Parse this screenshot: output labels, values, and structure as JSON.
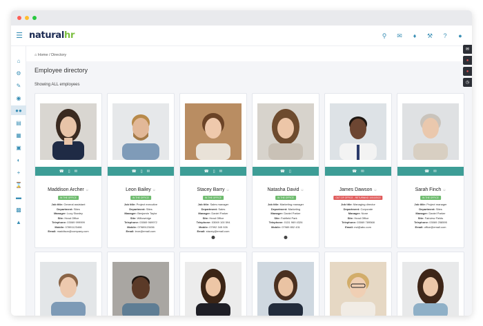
{
  "app": {
    "logo_main": "natural",
    "logo_accent": "hr"
  },
  "breadcrumb": {
    "home": "Home",
    "separator": "/",
    "current": "Directory"
  },
  "page": {
    "title": "Employee directory",
    "subtitle": "Showing ALL employees"
  },
  "colors": {
    "accent": "#3a8fb5",
    "teal": "#3d9d96",
    "in_office": "#6dbb6d",
    "out_office": "#e05a5a"
  },
  "employees": [
    {
      "name": "Maddison Archer",
      "status": "IN THE OFFICE",
      "status_type": "in",
      "job_title": "General assistant",
      "department": "Sites",
      "manager": "Lucy Stanley",
      "site": "Head Office",
      "telephone": "03069 999999",
      "mobile": "07891123466",
      "email": "maddison@company.com",
      "actions": [
        "phone",
        "mobile",
        "mail"
      ]
    },
    {
      "name": "Leon Bailey",
      "status": "IN THE OFFICE",
      "status_type": "in",
      "job_title": "Project executive",
      "department": "Sites",
      "manager": "Benjamin Taylor",
      "site": "Willowridge",
      "telephone": "03069 969972",
      "mobile": "07989123456",
      "email": "leon@email.com",
      "actions": [
        "phone",
        "mobile",
        "mail"
      ]
    },
    {
      "name": "Stacey Barry",
      "status": "IN THE OFFICE",
      "status_type": "in",
      "job_title": "Sales manager",
      "department": "Sales",
      "manager": "Daniel Parker",
      "site": "Head Office",
      "telephone": "03069 100 594",
      "mobile": "07992 345 926",
      "email": "stacey@email.com",
      "actions": [
        "phone",
        "mobile",
        "mail"
      ]
    },
    {
      "name": "Natasha David",
      "status": "IN THE OFFICE",
      "status_type": "in",
      "job_title": "Marketing manager",
      "department": "Marketing",
      "manager": "Daniel Parker",
      "site": "Fairfield Park",
      "telephone": "0131 969 4326",
      "mobile": "07989 852 431",
      "email": "",
      "actions": [
        "phone",
        "mobile"
      ]
    },
    {
      "name": "James Dawson",
      "status": "OUT OF OFFICE - RETURNING 10/10/2022",
      "status_type": "out",
      "job_title": "Managing director",
      "department": "Corporate",
      "manager": "None",
      "site": "Head Office",
      "telephone": "03069 789568",
      "mobile": "",
      "email": "md@abc.com",
      "actions": [
        "phone",
        "mail"
      ]
    },
    {
      "name": "Sarah Finch",
      "status": "IN THE OFFICE",
      "status_type": "in",
      "job_title": "Project manager",
      "department": "Sites",
      "manager": "Daniel Parker",
      "site": "Fairview Fields",
      "telephone": "03069 258595",
      "mobile": "",
      "email": "office@email.com",
      "actions": [
        "phone",
        "mail"
      ]
    }
  ],
  "labels": {
    "job_title": "Job title:",
    "department": "Department:",
    "manager": "Manager:",
    "site": "Site:",
    "telephone": "Telephone:",
    "mobile": "Mobile:",
    "email": "Email:"
  }
}
